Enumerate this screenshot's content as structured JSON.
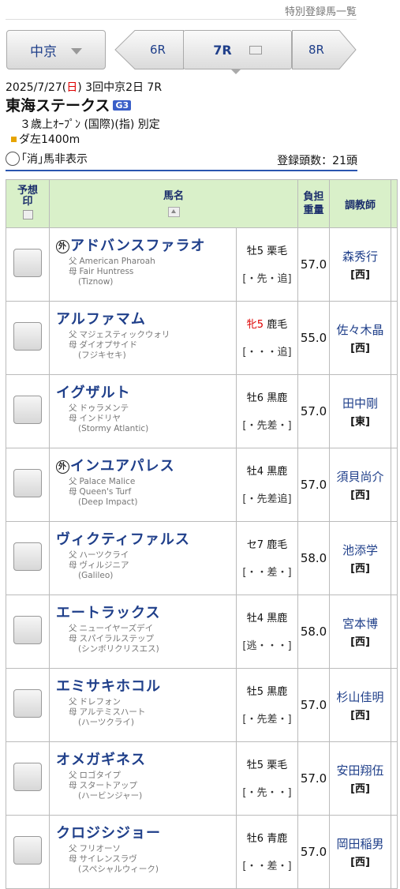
{
  "top_link": "特別登録馬一覧",
  "nav": {
    "venue": "中京",
    "prev": "6R",
    "current": "7R",
    "next": "8R"
  },
  "race": {
    "date_pre": "2025/7/27(",
    "date_day": "日",
    "date_post": ") 3回中京2日 7R",
    "name": "東海ステークス",
    "grade": "G3",
    "conditions": "３歳上ｵｰﾌﾟﾝ (国際)(指) 別定",
    "distance": "ダ左1400m"
  },
  "options": {
    "hide_scratched": "｢消｣馬非表示",
    "reg_count": "登録頭数：21頭"
  },
  "headers": {
    "mark": "予想印",
    "name": "馬名",
    "weight": "負担重量",
    "trainer": "調教師"
  },
  "horses": [
    {
      "foreign": "外",
      "name": "アドバンスファラオ",
      "sire": "American Pharoah",
      "dam": "Fair Huntress",
      "bms": "(Tiznow)",
      "sexage": "牡5",
      "coat": "栗毛",
      "female": false,
      "style": "[・先・追]",
      "weight": "57.0",
      "trainer": "森秀行",
      "region": "[西]"
    },
    {
      "foreign": "",
      "name": "アルファマム",
      "sire": "マジェスティックウォリ",
      "dam": "ダイオプサイド",
      "bms": "(フジキセキ)",
      "sexage": "牝5",
      "coat": "鹿毛",
      "female": true,
      "style": "[・・・追]",
      "weight": "55.0",
      "trainer": "佐々木晶",
      "region": "[西]"
    },
    {
      "foreign": "",
      "name": "イグザルト",
      "sire": "ドゥラメンテ",
      "dam": "インドリヤ",
      "bms": "(Stormy Atlantic)",
      "sexage": "牡6",
      "coat": "黒鹿",
      "female": false,
      "style": "[・先差・]",
      "weight": "57.0",
      "trainer": "田中剛",
      "region": "[東]"
    },
    {
      "foreign": "外",
      "name": "インユアパレス",
      "sire": "Palace Malice",
      "dam": "Queen's Turf",
      "bms": "(Deep Impact)",
      "sexage": "牡4",
      "coat": "黒鹿",
      "female": false,
      "style": "[・先差追]",
      "weight": "57.0",
      "trainer": "須貝尚介",
      "region": "[西]"
    },
    {
      "foreign": "",
      "name": "ヴィクティファルス",
      "sire": "ハーツクライ",
      "dam": "ヴィルジニア",
      "bms": "(Galileo)",
      "sexage": "セ7",
      "coat": "鹿毛",
      "female": false,
      "style": "[・・差・]",
      "weight": "58.0",
      "trainer": "池添学",
      "region": "[西]"
    },
    {
      "foreign": "",
      "name": "エートラックス",
      "sire": "ニューイヤーズデイ",
      "dam": "スパイラルステップ",
      "bms": "(シンボリクリスエス)",
      "sexage": "牡4",
      "coat": "黒鹿",
      "female": false,
      "style": "[逃・・・]",
      "weight": "58.0",
      "trainer": "宮本博",
      "region": "[西]"
    },
    {
      "foreign": "",
      "name": "エミサキホコル",
      "sire": "ドレフォン",
      "dam": "アルテミスハート",
      "bms": "(ハーツクライ)",
      "sexage": "牡5",
      "coat": "黒鹿",
      "female": false,
      "style": "[・先差・]",
      "weight": "57.0",
      "trainer": "杉山佳明",
      "region": "[西]"
    },
    {
      "foreign": "",
      "name": "オメガギネス",
      "sire": "ロゴタイプ",
      "dam": "スタートアップ",
      "bms": "(ハービンジャー)",
      "sexage": "牡5",
      "coat": "栗毛",
      "female": false,
      "style": "[・先・・]",
      "weight": "57.0",
      "trainer": "安田翔伍",
      "region": "[西]"
    },
    {
      "foreign": "",
      "name": "クロジシジョー",
      "sire": "フリオーソ",
      "dam": "サイレンスラヴ",
      "bms": "(スペシャルウィーク)",
      "sexage": "牡6",
      "coat": "青鹿",
      "female": false,
      "style": "[・・差・]",
      "weight": "57.0",
      "trainer": "岡田稲男",
      "region": "[西]"
    }
  ],
  "pedigree_labels": {
    "sire": "父",
    "dam": "母"
  }
}
